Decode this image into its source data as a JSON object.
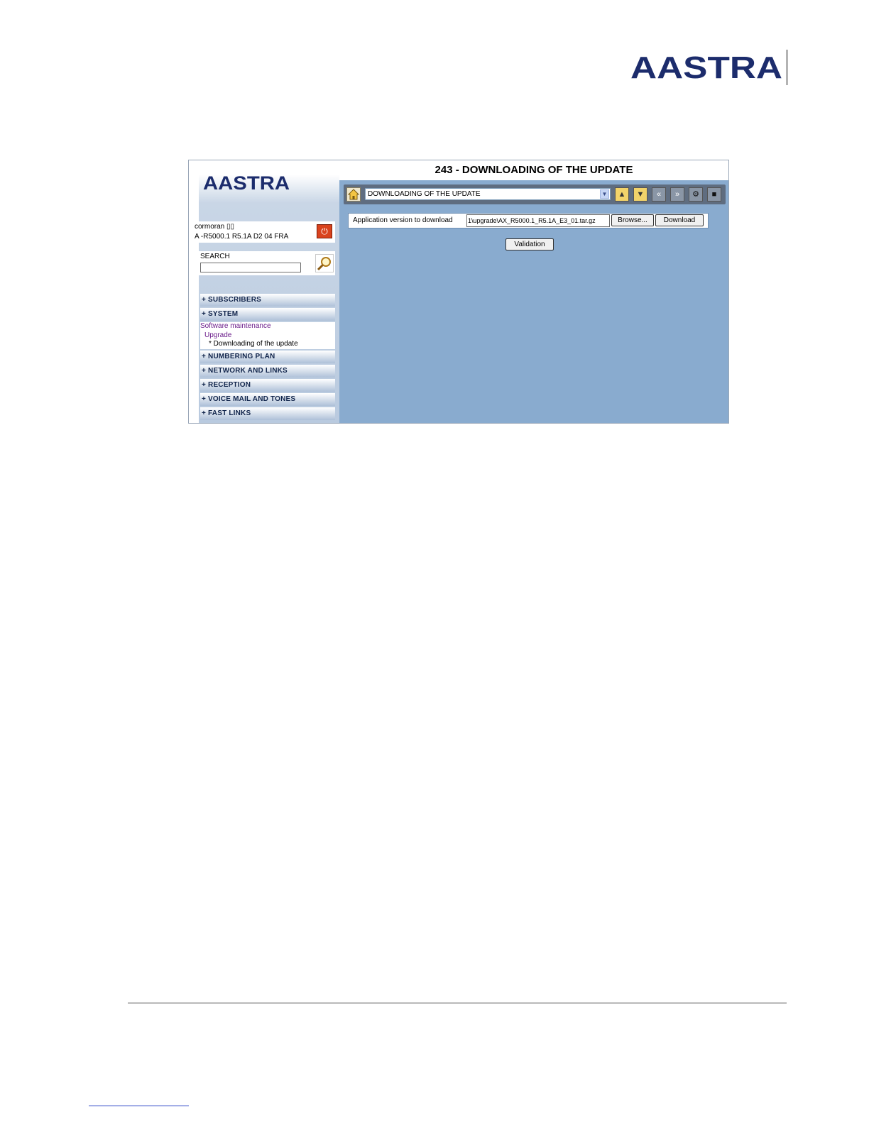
{
  "document": {
    "brand": "AASTRA"
  },
  "screen": {
    "title": "243 - DOWNLOADING OF THE UPDATE",
    "brand": "AASTRA",
    "user": {
      "line1": "cormoran ▯▯",
      "line2": "A    -R5000.1 R5.1A D2 04 FRA"
    },
    "search": {
      "label": "SEARCH",
      "value": ""
    },
    "menu": {
      "items": [
        {
          "label": "+ SUBSCRIBERS"
        },
        {
          "label": "+ SYSTEM"
        },
        {
          "label": "+ NUMBERING PLAN"
        },
        {
          "label": "+ NETWORK AND LINKS"
        },
        {
          "label": "+ RECEPTION"
        },
        {
          "label": "+ VOICE MAIL AND TONES"
        },
        {
          "label": "+ FAST LINKS"
        }
      ],
      "system_sub": {
        "level1": "Software maintenance",
        "level2": "Upgrade",
        "level3": "* Downloading of the update"
      }
    },
    "toolbar": {
      "selected_page": "DOWNLOADING OF THE UPDATE"
    },
    "form": {
      "label": "Application version to download",
      "value": "1\\upgrade\\AX_R5000.1_R5.1A_E3_01.tar.gz",
      "browse_label": "Browse...",
      "download_label": "Download",
      "validation_label": "Validation"
    }
  },
  "colors": {
    "panel_blue": "#89abcf",
    "toolbar_gray": "#5f6d80",
    "menu_text": "#10244b",
    "logo_navy": "#1c2c6c",
    "power_red": "#d9431e"
  }
}
